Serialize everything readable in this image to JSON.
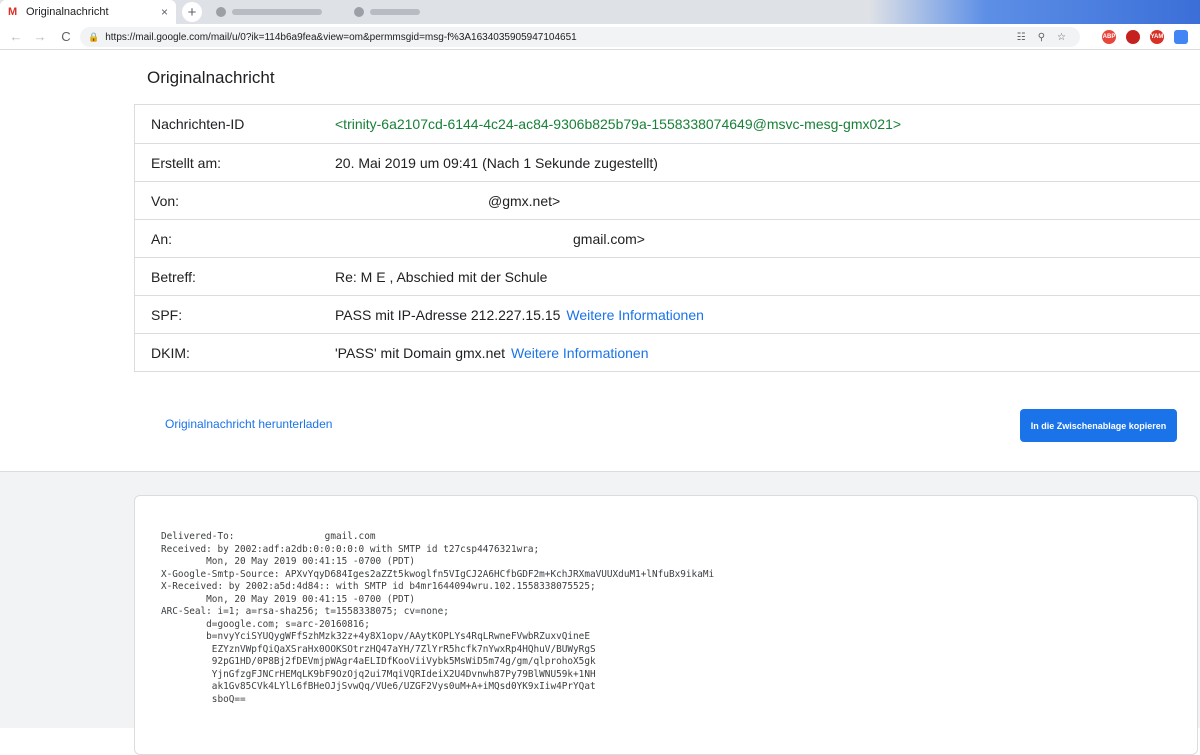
{
  "browser": {
    "active_tab": {
      "icon": "gmail-icon",
      "title": "Originalnachricht",
      "close": "×"
    },
    "new_tab": "+",
    "url": "https://mail.google.com/mail/u/0?ik=114b6a9fea&view=om&permmsgid=msg-f%3A1634035905947104651",
    "nav": {
      "back": "←",
      "forward": "→",
      "reload": "C"
    },
    "extensions": [
      {
        "name": "adblock-icon",
        "label": "ABP",
        "color": "#e8453c"
      },
      {
        "name": "ublock-icon",
        "label": "",
        "color": "#c5221f"
      },
      {
        "name": "extension-icon",
        "label": "YAM",
        "color": "#d93025"
      },
      {
        "name": "extension-blue-icon",
        "label": "",
        "color": "#4285f4"
      }
    ]
  },
  "page": {
    "title": "Originalnachricht",
    "rows": [
      {
        "label": "Nachrichten-ID",
        "value": "<trinity-6a2107cd-6144-4c24-ac84-9306b825b79a-1558338074649@msvc-mesg-gmx021>",
        "value_offset": 0,
        "link": ""
      },
      {
        "label": "Erstellt am:",
        "value": "20. Mai 2019 um 09:41 (Nach 1 Sekunde zugestellt)",
        "value_offset": 0,
        "link": ""
      },
      {
        "label": "Von:",
        "value": "@gmx.net>",
        "value_offset": 153,
        "link": ""
      },
      {
        "label": "An:",
        "value": "gmail.com>",
        "value_offset": 238,
        "link": ""
      },
      {
        "label": "Betreff:",
        "value": "Re: M        E       , Abschied mit der Schule",
        "value_offset": 0,
        "link": ""
      },
      {
        "label": "SPF:",
        "value": "PASS mit IP-Adresse 212.227.15.15",
        "value_offset": 0,
        "link": "Weitere Informationen"
      },
      {
        "label": "DKIM:",
        "value": "'PASS' mit Domain gmx.net",
        "value_offset": 0,
        "link": "Weitere Informationen"
      }
    ],
    "download_link": "Originalnachricht herunterladen",
    "copy_button": "In die Zwischenablage kopieren"
  },
  "source": {
    "text": "Delivered-To:                gmail.com\nReceived: by 2002:adf:a2db:0:0:0:0:0 with SMTP id t27csp4476321wra;\n        Mon, 20 May 2019 00:41:15 -0700 (PDT)\nX-Google-Smtp-Source: APXvYqyD684Iges2aZZt5kwoglfn5VIgCJ2A6HCfbGDF2m+KchJRXmaVUUXduM1+lNfuBx9ikaMi\nX-Received: by 2002:a5d:4d84:: with SMTP id b4mr1644094wru.102.1558338075525;\n        Mon, 20 May 2019 00:41:15 -0700 (PDT)\nARC-Seal: i=1; a=rsa-sha256; t=1558338075; cv=none;\n        d=google.com; s=arc-20160816;\n        b=nvyYciSYUQygWFfSzhMzk32z+4y8X1opv/AAytKOPLYs4RqLRwneFVwbRZuxvQineE\n         EZYznVWpfQiQaXSraHx0OOKSOtrzHQ47aYH/7ZlYrR5hcfk7nYwxRp4HQhuV/BUWyRgS\n         92pG1HD/0P8Bj2fDEVmjpWAgr4aELIDfKooViiVybk5MsWiD5m74g/gm/qlprohoX5gk\n         YjnGfzgFJNCrHEMqLK9bF9OzOjq2ui7MqiVQRIdeiX2U4Dvnwh87Py79BlWNU59k+1NH\n         ak1Gv85CVk4LYlL6fBHeOJjSvwQq/VUe6/UZGF2Vys0uM+A+iMQsd0YK9xIiw4PrYQat\n         sboQ=="
  }
}
